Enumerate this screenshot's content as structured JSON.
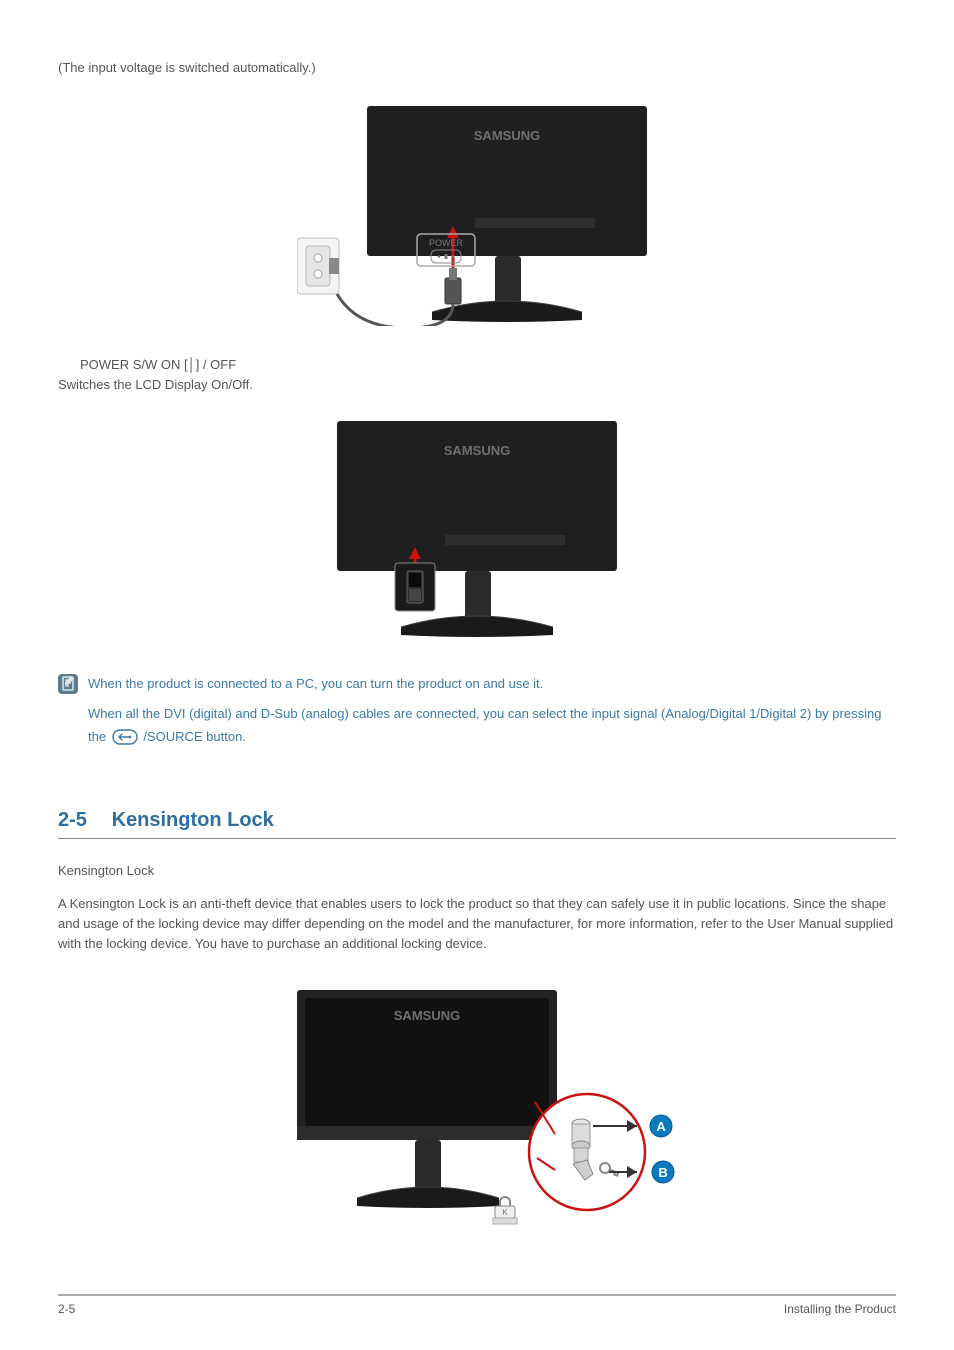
{
  "intro_line": "(The input voltage is switched automatically.)",
  "power_sw": {
    "line1": "POWER S/W ON [│] / OFF",
    "line2": "Switches the LCD Display On/Off."
  },
  "note": {
    "p1": "When the product is connected to a PC, you can turn the product on and use it.",
    "p2a": "When all the DVI (digital) and D-Sub (analog) cables are connected, you can select the input signal (Analog/Digital 1/Digital 2) by pressing the ",
    "p2b": " /SOURCE button."
  },
  "section": {
    "number": "2-5",
    "title": "Kensington Lock"
  },
  "kensington": {
    "subtitle": "Kensington Lock",
    "body": "A Kensington Lock is an anti-theft device that enables users to lock the product so that they can safely use it in public locations. Since the shape and usage of the locking device may differ depending on the model and the manufacturer, for more information, refer to the User Manual supplied with the locking device. You have to purchase an additional locking device."
  },
  "footer": {
    "left": "2-5",
    "right": "Installing the Product"
  },
  "brand": "SAMSUNG",
  "labels": {
    "power": "POWER",
    "A": "A",
    "B": "B"
  }
}
